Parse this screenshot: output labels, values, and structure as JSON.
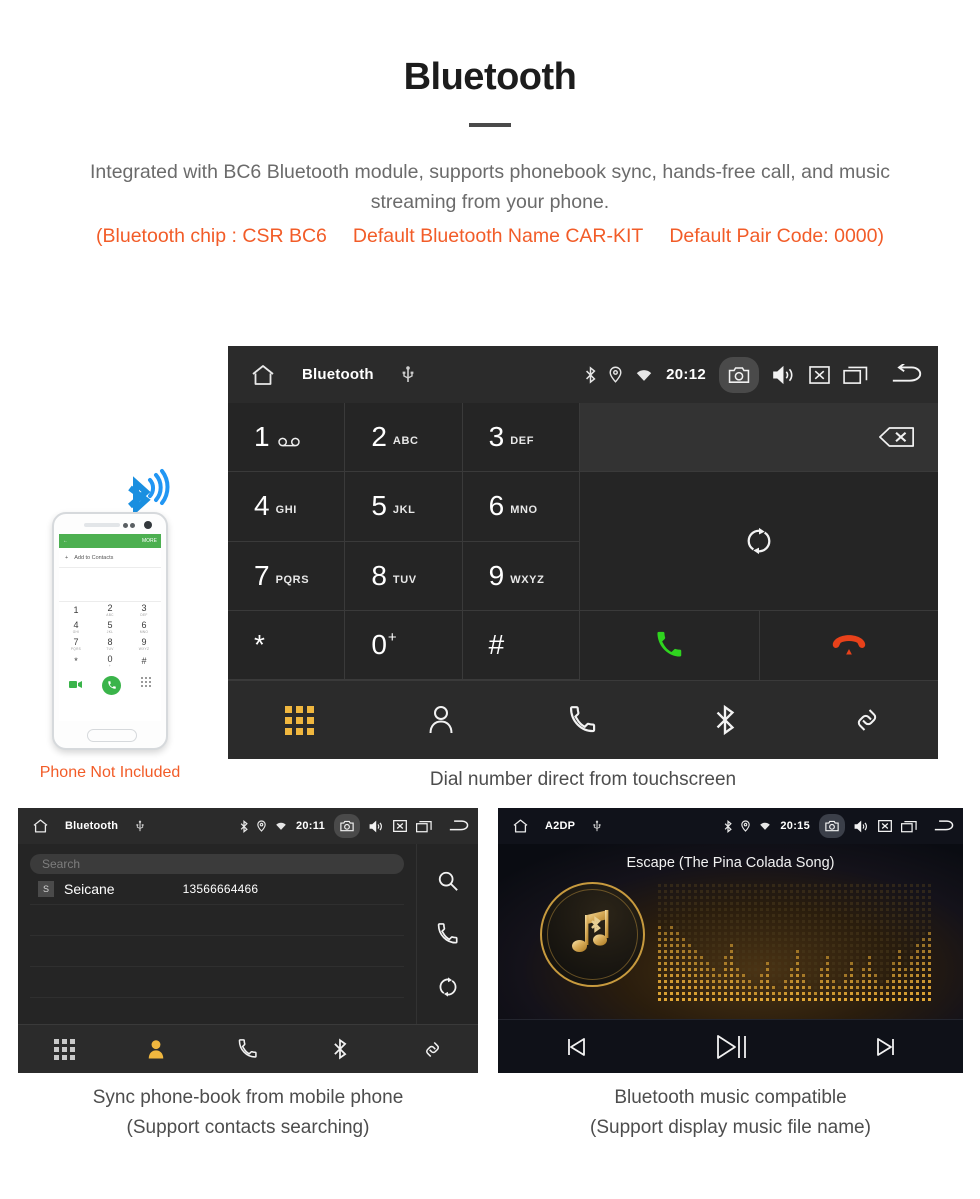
{
  "header": {
    "title": "Bluetooth",
    "intro": "Integrated with BC6 Bluetooth module, supports phonebook sync, hands-free call, and music streaming from your phone.",
    "spec_chip": "(Bluetooth chip : CSR BC6",
    "spec_name": "Default Bluetooth Name CAR-KIT",
    "spec_pair": "Default Pair Code: 0000)"
  },
  "colors": {
    "accent_orange": "#f25c28",
    "tab_active": "#f0b73f",
    "call_green": "#2fd41f",
    "end_red": "#e8411a",
    "panel_bg": "#252525",
    "statusbar_bg": "#2b2b2b",
    "gold": "#c79a3e"
  },
  "dialer": {
    "statusbar": {
      "home_icon": "home-icon",
      "title": "Bluetooth",
      "usb_icon": "usb-icon",
      "bluetooth_icon": "bluetooth-icon",
      "location_icon": "location-icon",
      "wifi_icon": "wifi-icon",
      "clock": "20:12",
      "camera_icon": "camera-icon",
      "volume_icon": "volume-icon",
      "close_icon": "close-box-icon",
      "recents_icon": "recents-icon",
      "back_icon": "back-icon"
    },
    "keys": [
      {
        "num": "1",
        "sub": "",
        "voicemail": true
      },
      {
        "num": "2",
        "sub": "ABC"
      },
      {
        "num": "3",
        "sub": "DEF"
      },
      {
        "num": "4",
        "sub": "GHI"
      },
      {
        "num": "5",
        "sub": "JKL"
      },
      {
        "num": "6",
        "sub": "MNO"
      },
      {
        "num": "7",
        "sub": "PQRS"
      },
      {
        "num": "8",
        "sub": "TUV"
      },
      {
        "num": "9",
        "sub": "WXYZ"
      },
      {
        "num": "*",
        "sub": ""
      },
      {
        "num": "0",
        "sub": "",
        "plus": "+"
      },
      {
        "num": "#",
        "sub": ""
      }
    ],
    "number_input_value": "",
    "backspace_icon": "backspace-icon",
    "switch_icon": "switch-audio-icon",
    "call_icon": "call-icon",
    "end_call_icon": "end-call-icon",
    "tabs": [
      {
        "name": "keypad",
        "icon": "keypad-icon",
        "active": true
      },
      {
        "name": "contacts",
        "icon": "contact-icon",
        "active": false
      },
      {
        "name": "history",
        "icon": "call-history-icon",
        "active": false
      },
      {
        "name": "bluetooth",
        "icon": "bluetooth-icon",
        "active": false
      },
      {
        "name": "link",
        "icon": "link-icon",
        "active": false
      }
    ],
    "caption": "Dial number direct from touchscreen"
  },
  "phone_illustration": {
    "screen_bar_more": "MORE",
    "add_contacts": "Add to Contacts",
    "keys": [
      {
        "num": "1",
        "sub": ""
      },
      {
        "num": "2",
        "sub": "ABC"
      },
      {
        "num": "3",
        "sub": "DEF"
      },
      {
        "num": "4",
        "sub": "GHI"
      },
      {
        "num": "5",
        "sub": "JKL"
      },
      {
        "num": "6",
        "sub": "MNO"
      },
      {
        "num": "7",
        "sub": "PQRS"
      },
      {
        "num": "8",
        "sub": "TUV"
      },
      {
        "num": "9",
        "sub": "WXYZ"
      },
      {
        "num": "*",
        "sub": ""
      },
      {
        "num": "0",
        "sub": "+"
      },
      {
        "num": "#",
        "sub": ""
      }
    ],
    "caption": "Phone Not Included"
  },
  "phonebook": {
    "statusbar": {
      "title": "Bluetooth",
      "clock": "20:11"
    },
    "search_placeholder": "Search",
    "contacts": [
      {
        "badge": "S",
        "name": "Seicane",
        "number": "13566664466"
      }
    ],
    "side_icons": [
      "search-icon",
      "call-icon",
      "sync-icon"
    ],
    "tabs": [
      {
        "name": "keypad",
        "icon": "keypad-icon",
        "active": false
      },
      {
        "name": "contacts",
        "icon": "contact-icon",
        "active": true
      },
      {
        "name": "history",
        "icon": "call-history-icon",
        "active": false
      },
      {
        "name": "bluetooth",
        "icon": "bluetooth-icon",
        "active": false
      },
      {
        "name": "link",
        "icon": "link-icon",
        "active": false
      }
    ],
    "caption_line1": "Sync phone-book from mobile phone",
    "caption_line2": "(Support contacts searching)"
  },
  "music": {
    "statusbar": {
      "title": "A2DP",
      "clock": "20:15"
    },
    "song_title": "Escape (The Pina Colada Song)",
    "album_icon": "music-bluetooth-icon",
    "visualizer": "dot-matrix-spectrum",
    "controls": [
      {
        "name": "previous",
        "icon": "previous-track-icon"
      },
      {
        "name": "play-pause",
        "icon": "play-pause-icon"
      },
      {
        "name": "next",
        "icon": "next-track-icon"
      }
    ],
    "caption_line1": "Bluetooth music compatible",
    "caption_line2": "(Support display music file name)"
  }
}
